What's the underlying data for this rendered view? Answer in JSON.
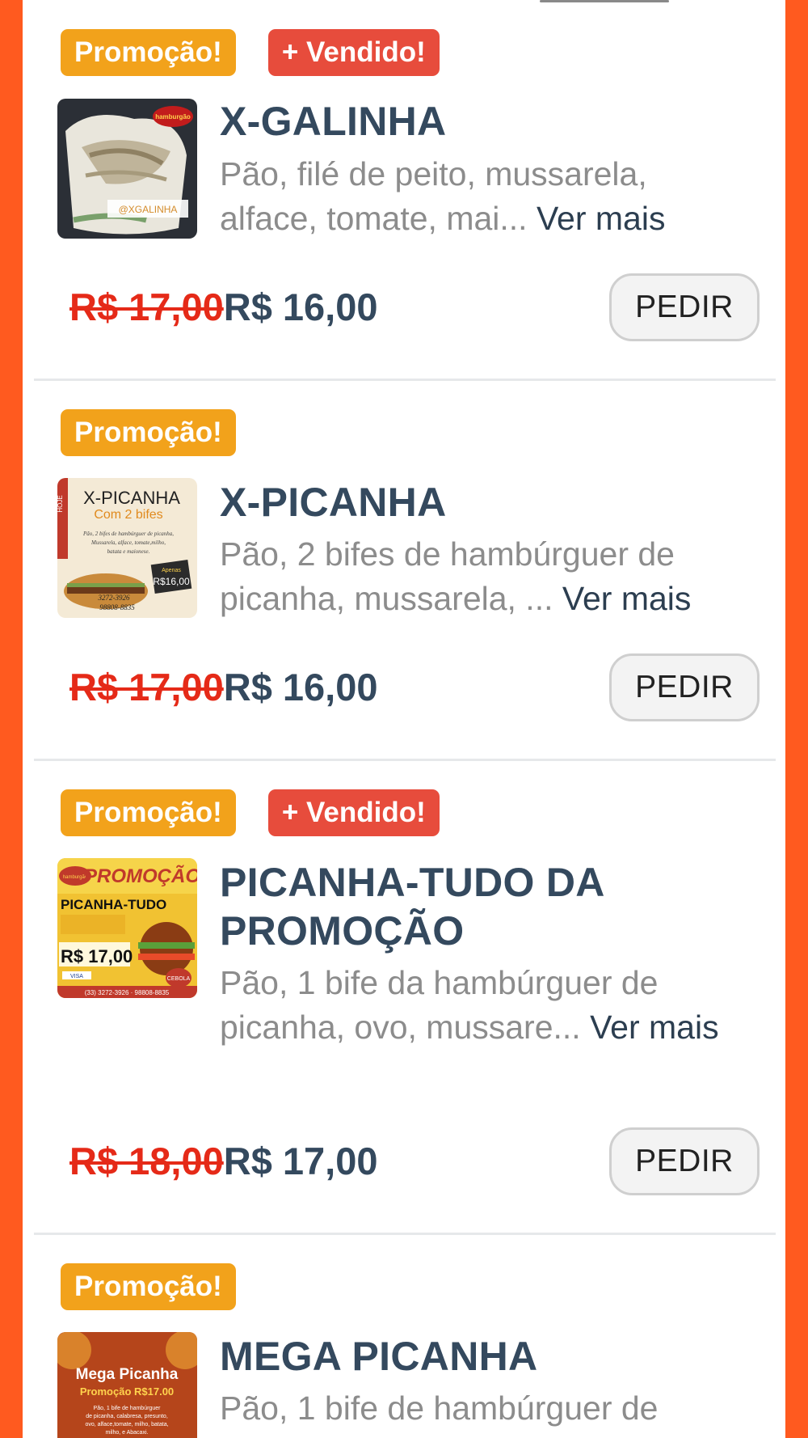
{
  "items": [
    {
      "badges": [
        "Promoção!",
        "+ Vendido!"
      ],
      "name": "X-GALINHA",
      "description": "Pão, filé de peito, mussarela, alface, tomate, mai...",
      "more": "Ver mais",
      "old_price": "R$ 17,00",
      "price": "R$ 16,00",
      "button": "PEDIR",
      "image_text": [
        "hamburgão",
        "@XGALINHA"
      ]
    },
    {
      "badges": [
        "Promoção!"
      ],
      "name": "X-PICANHA",
      "description": "Pão, 2 bifes de hambúrguer de picanha, mussarela, ...",
      "more": "Ver mais",
      "old_price": "R$ 17,00",
      "price": "R$ 16,00",
      "button": "PEDIR",
      "image_text": [
        "HOJE",
        "X-PICANHA",
        "Com 2 bifes",
        "Pão, 2 bifes de hambúrguer de picanha,",
        "Mussarela, alface, tomate,milho,",
        "batata e maionese.",
        "Apenas",
        "R$16,00",
        "3272-3926",
        "98808-8835"
      ]
    },
    {
      "badges": [
        "Promoção!",
        "+ Vendido!"
      ],
      "name": "PICANHA-TUDO DA PROMOÇÃO",
      "description": "Pão, 1 bife da hambúrguer de picanha, ovo, mussare...",
      "more": "Ver mais",
      "old_price": "R$ 18,00",
      "price": "R$ 17,00",
      "button": "PEDIR",
      "image_text": [
        "hamburgão",
        "PROMOÇÃO",
        "PICANHA-TUDO",
        "R$ 17,00",
        "VISA",
        "CEBOLA",
        "(33) 3272-3926 · 98808-8835"
      ]
    },
    {
      "badges": [
        "Promoção!"
      ],
      "name": "MEGA PICANHA",
      "description": "Pão, 1 bife de hambúrguer de",
      "more": "",
      "image_text": [
        "Mega Picanha",
        "Promoção R$17.00",
        "Pão, 1 bife de hambúrguer",
        "de picanha, calabresa, presunto,",
        "ovo, alface,tomate, milho, batata,",
        "milho, e Abacaxi."
      ]
    }
  ],
  "colors": {
    "background": "#FF5A1F",
    "promo_badge": "#F2A21B",
    "sold_badge": "#E74C3C",
    "title": "#34495E",
    "description": "#8C8C8C",
    "old_price": "#E52A18"
  }
}
